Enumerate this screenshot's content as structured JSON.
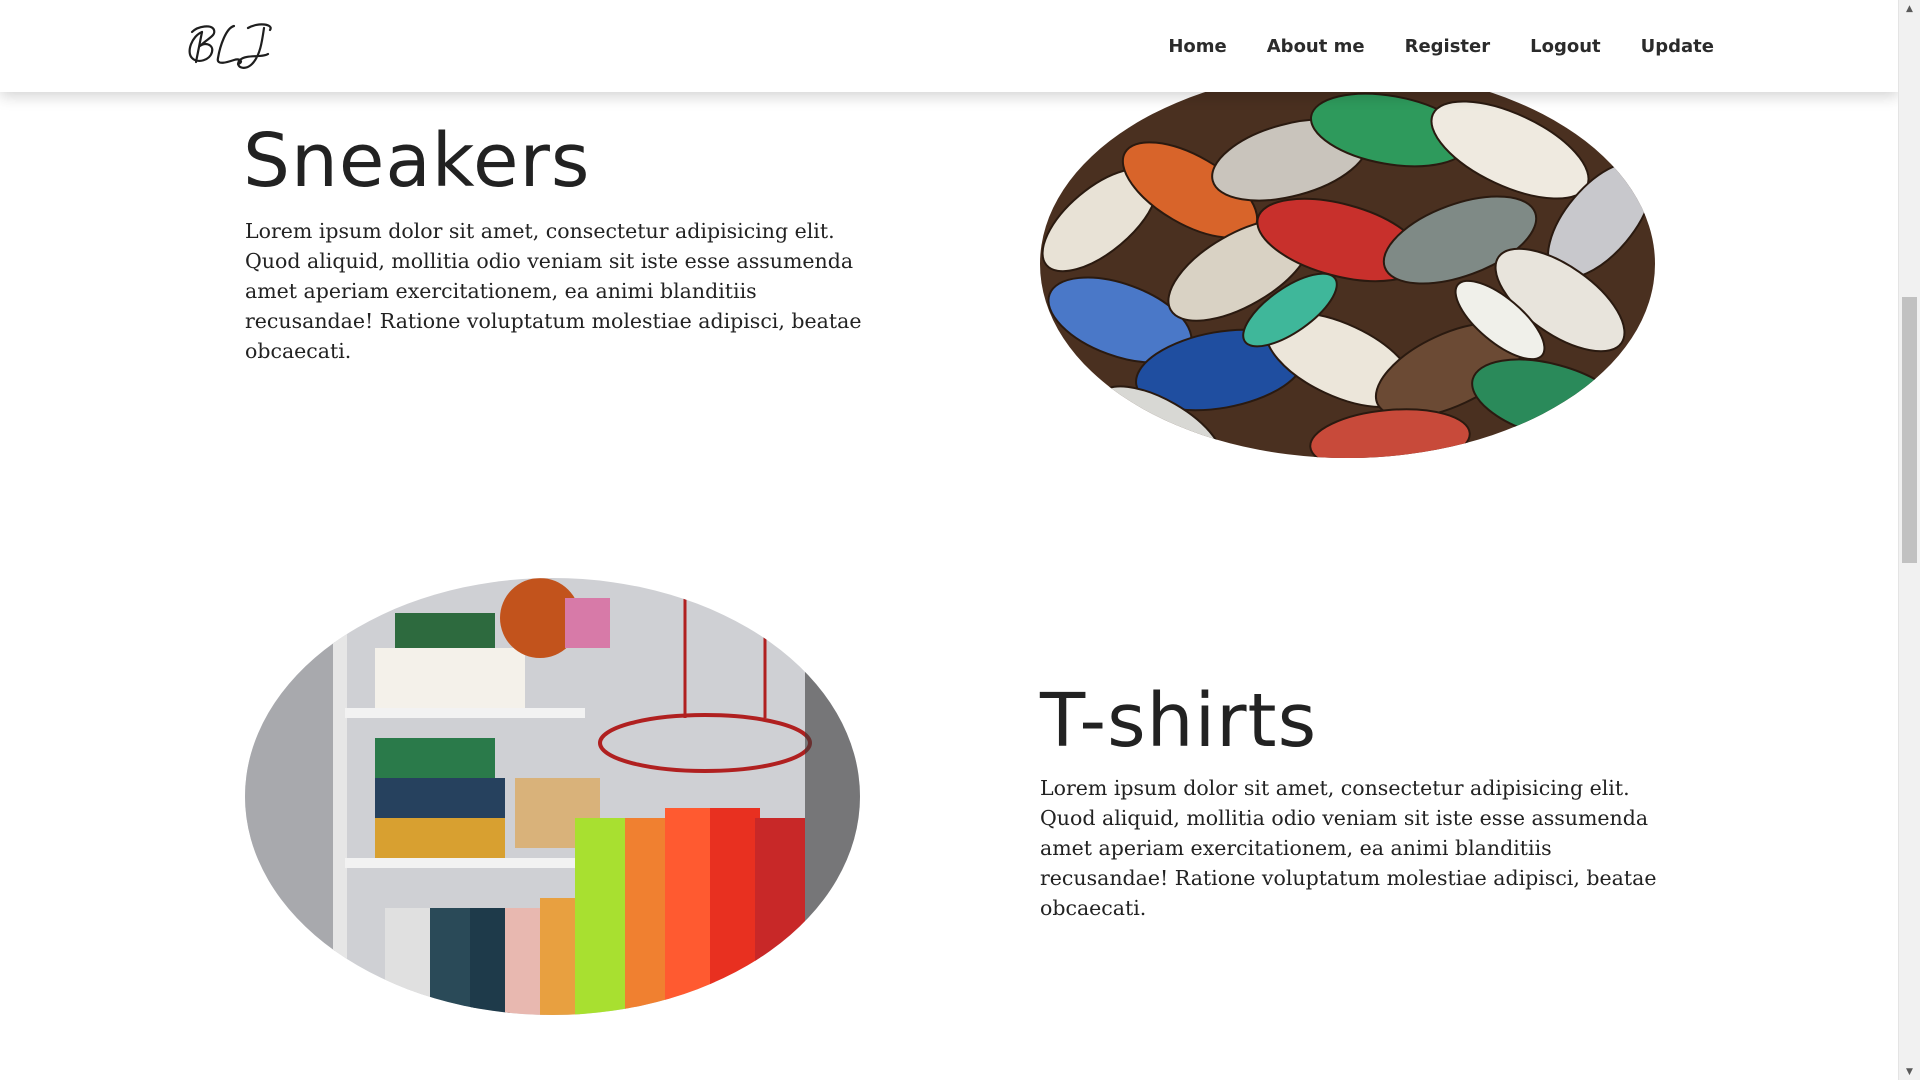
{
  "navbar": {
    "logo_text": "BLJ",
    "links": [
      "Home",
      "About me",
      "Register",
      "Logout",
      "Update"
    ]
  },
  "sections": [
    {
      "title": "Sneakers",
      "text": "Lorem ipsum dolor sit amet, consectetur adipisicing elit. Quod aliquid, mollitia odio veniam sit iste esse assumenda amet aperiam exercitationem, ea animi blanditiis recusandae! Ratione voluptatum molestiae adipisci, beatae obcaecati."
    },
    {
      "title": "T-shirts",
      "text": "Lorem ipsum dolor sit amet, consectetur adipisicing elit. Quod aliquid, mollitia odio veniam sit iste esse assumenda amet aperiam exercitationem, ea animi blanditiis recusandae! Ratione voluptatum molestiae adipisci, beatae obcaecati."
    }
  ],
  "colors": {
    "text": "#222222",
    "navbar_bg": "#ffffff",
    "scrollbar_thumb": "#c1c1c1"
  }
}
